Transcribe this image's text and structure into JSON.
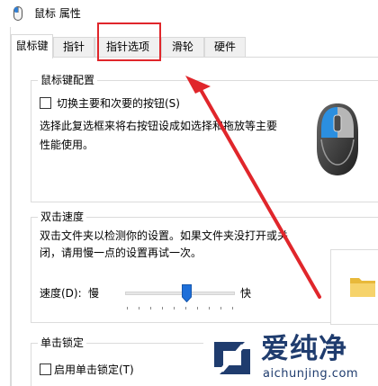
{
  "window": {
    "title": "鼠标 属性",
    "icon": "mouse-icon"
  },
  "tabs": [
    {
      "label": "鼠标键",
      "active": true
    },
    {
      "label": "指针",
      "active": false
    },
    {
      "label": "指针选项",
      "active": false
    },
    {
      "label": "滑轮",
      "active": false
    },
    {
      "label": "硬件",
      "active": false
    }
  ],
  "button_config": {
    "title": "鼠标键配置",
    "swap_label": "切换主要和次要的按钮(S)",
    "swap_checked": false,
    "description_line1": "选择此复选框来将右按钮设成如选择和拖放等主要",
    "description_line2": "性能使用。"
  },
  "double_click": {
    "title": "双击速度",
    "description_line1": "双击文件夹以检测你的设置。如果文件夹没打开或关",
    "description_line2": "闭，请用慢一点的设置再试一次。",
    "speed_label": "速度(D):",
    "slow_label": "慢",
    "fast_label": "快",
    "speed_value_fraction": 0.56
  },
  "click_lock": {
    "title": "单击锁定",
    "enable_label": "启用单击锁定(T)",
    "enable_checked": false
  },
  "annotation": {
    "highlight_color": "#e0262b"
  },
  "watermark": {
    "brand": "爱纯净",
    "url": "aichunjing.com"
  }
}
